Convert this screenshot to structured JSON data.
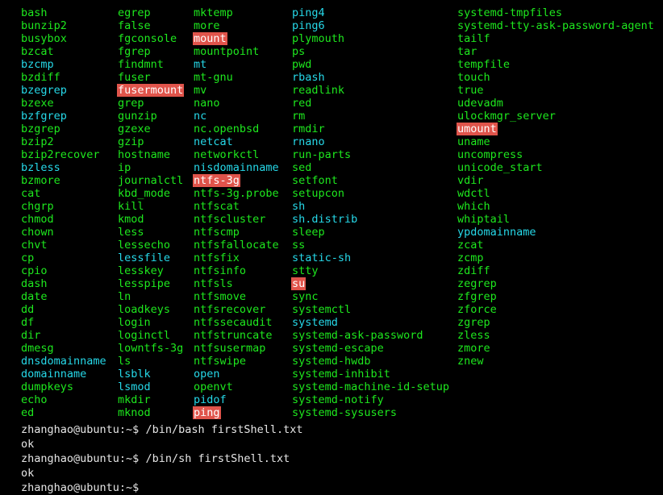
{
  "terminal": {
    "title": "bash completion listing",
    "background_color": "#000000",
    "green_color": "#1ee81e",
    "cyan_color": "#26d8e8",
    "highlight_bg_color": "#e0544b",
    "highlight_fg_color": "#ffffff",
    "prompt_color": "#e6e6e6"
  },
  "completions": {
    "columns": [
      {
        "index": 0,
        "items": [
          {
            "name": "bash",
            "style": "green"
          },
          {
            "name": "bunzip2",
            "style": "green"
          },
          {
            "name": "busybox",
            "style": "green"
          },
          {
            "name": "bzcat",
            "style": "green"
          },
          {
            "name": "bzcmp",
            "style": "cyan"
          },
          {
            "name": "bzdiff",
            "style": "green"
          },
          {
            "name": "bzegrep",
            "style": "cyan"
          },
          {
            "name": "bzexe",
            "style": "green"
          },
          {
            "name": "bzfgrep",
            "style": "cyan"
          },
          {
            "name": "bzgrep",
            "style": "green"
          },
          {
            "name": "bzip2",
            "style": "green"
          },
          {
            "name": "bzip2recover",
            "style": "green"
          },
          {
            "name": "bzless",
            "style": "cyan"
          },
          {
            "name": "bzmore",
            "style": "green"
          },
          {
            "name": "cat",
            "style": "green"
          },
          {
            "name": "chgrp",
            "style": "green"
          },
          {
            "name": "chmod",
            "style": "green"
          },
          {
            "name": "chown",
            "style": "green"
          },
          {
            "name": "chvt",
            "style": "green"
          },
          {
            "name": "cp",
            "style": "green"
          },
          {
            "name": "cpio",
            "style": "green"
          },
          {
            "name": "dash",
            "style": "green"
          },
          {
            "name": "date",
            "style": "green"
          },
          {
            "name": "dd",
            "style": "green"
          },
          {
            "name": "df",
            "style": "green"
          },
          {
            "name": "dir",
            "style": "green"
          },
          {
            "name": "dmesg",
            "style": "green"
          },
          {
            "name": "dnsdomainname",
            "style": "cyan"
          },
          {
            "name": "domainname",
            "style": "cyan"
          },
          {
            "name": "dumpkeys",
            "style": "green"
          },
          {
            "name": "echo",
            "style": "green"
          },
          {
            "name": "ed",
            "style": "green"
          }
        ]
      },
      {
        "index": 1,
        "items": [
          {
            "name": "egrep",
            "style": "green"
          },
          {
            "name": "false",
            "style": "green"
          },
          {
            "name": "fgconsole",
            "style": "green"
          },
          {
            "name": "fgrep",
            "style": "green"
          },
          {
            "name": "findmnt",
            "style": "green"
          },
          {
            "name": "fuser",
            "style": "green"
          },
          {
            "name": "fusermount",
            "style": "highlight"
          },
          {
            "name": "grep",
            "style": "green"
          },
          {
            "name": "gunzip",
            "style": "green"
          },
          {
            "name": "gzexe",
            "style": "green"
          },
          {
            "name": "gzip",
            "style": "green"
          },
          {
            "name": "hostname",
            "style": "green"
          },
          {
            "name": "ip",
            "style": "green"
          },
          {
            "name": "journalctl",
            "style": "green"
          },
          {
            "name": "kbd_mode",
            "style": "green"
          },
          {
            "name": "kill",
            "style": "green"
          },
          {
            "name": "kmod",
            "style": "green"
          },
          {
            "name": "less",
            "style": "green"
          },
          {
            "name": "lessecho",
            "style": "green"
          },
          {
            "name": "lessfile",
            "style": "cyan"
          },
          {
            "name": "lesskey",
            "style": "green"
          },
          {
            "name": "lesspipe",
            "style": "green"
          },
          {
            "name": "ln",
            "style": "green"
          },
          {
            "name": "loadkeys",
            "style": "green"
          },
          {
            "name": "login",
            "style": "green"
          },
          {
            "name": "loginctl",
            "style": "green"
          },
          {
            "name": "lowntfs-3g",
            "style": "green"
          },
          {
            "name": "ls",
            "style": "green"
          },
          {
            "name": "lsblk",
            "style": "cyan"
          },
          {
            "name": "lsmod",
            "style": "cyan"
          },
          {
            "name": "mkdir",
            "style": "green"
          },
          {
            "name": "mknod",
            "style": "green"
          }
        ]
      },
      {
        "index": 2,
        "items": [
          {
            "name": "mktemp",
            "style": "green"
          },
          {
            "name": "more",
            "style": "green"
          },
          {
            "name": "mount",
            "style": "highlight"
          },
          {
            "name": "mountpoint",
            "style": "green"
          },
          {
            "name": "mt",
            "style": "cyan"
          },
          {
            "name": "mt-gnu",
            "style": "green"
          },
          {
            "name": "mv",
            "style": "green"
          },
          {
            "name": "nano",
            "style": "green"
          },
          {
            "name": "nc",
            "style": "cyan"
          },
          {
            "name": "nc.openbsd",
            "style": "green"
          },
          {
            "name": "netcat",
            "style": "cyan"
          },
          {
            "name": "networkctl",
            "style": "green"
          },
          {
            "name": "nisdomainname",
            "style": "cyan"
          },
          {
            "name": "ntfs-3g",
            "style": "highlight"
          },
          {
            "name": "ntfs-3g.probe",
            "style": "green"
          },
          {
            "name": "ntfscat",
            "style": "green"
          },
          {
            "name": "ntfscluster",
            "style": "green"
          },
          {
            "name": "ntfscmp",
            "style": "green"
          },
          {
            "name": "ntfsfallocate",
            "style": "green"
          },
          {
            "name": "ntfsfix",
            "style": "green"
          },
          {
            "name": "ntfsinfo",
            "style": "green"
          },
          {
            "name": "ntfsls",
            "style": "green"
          },
          {
            "name": "ntfsmove",
            "style": "green"
          },
          {
            "name": "ntfsrecover",
            "style": "green"
          },
          {
            "name": "ntfssecaudit",
            "style": "green"
          },
          {
            "name": "ntfstruncate",
            "style": "green"
          },
          {
            "name": "ntfsusermap",
            "style": "green"
          },
          {
            "name": "ntfswipe",
            "style": "green"
          },
          {
            "name": "open",
            "style": "cyan"
          },
          {
            "name": "openvt",
            "style": "green"
          },
          {
            "name": "pidof",
            "style": "cyan"
          },
          {
            "name": "ping",
            "style": "highlight"
          }
        ]
      },
      {
        "index": 3,
        "items": [
          {
            "name": "ping4",
            "style": "cyan"
          },
          {
            "name": "ping6",
            "style": "cyan"
          },
          {
            "name": "plymouth",
            "style": "green"
          },
          {
            "name": "ps",
            "style": "green"
          },
          {
            "name": "pwd",
            "style": "green"
          },
          {
            "name": "rbash",
            "style": "cyan"
          },
          {
            "name": "readlink",
            "style": "green"
          },
          {
            "name": "red",
            "style": "green"
          },
          {
            "name": "rm",
            "style": "green"
          },
          {
            "name": "rmdir",
            "style": "green"
          },
          {
            "name": "rnano",
            "style": "cyan"
          },
          {
            "name": "run-parts",
            "style": "green"
          },
          {
            "name": "sed",
            "style": "green"
          },
          {
            "name": "setfont",
            "style": "green"
          },
          {
            "name": "setupcon",
            "style": "green"
          },
          {
            "name": "sh",
            "style": "cyan"
          },
          {
            "name": "sh.distrib",
            "style": "cyan"
          },
          {
            "name": "sleep",
            "style": "green"
          },
          {
            "name": "ss",
            "style": "green"
          },
          {
            "name": "static-sh",
            "style": "cyan"
          },
          {
            "name": "stty",
            "style": "green"
          },
          {
            "name": "su",
            "style": "highlight"
          },
          {
            "name": "sync",
            "style": "green"
          },
          {
            "name": "systemctl",
            "style": "green"
          },
          {
            "name": "systemd",
            "style": "cyan"
          },
          {
            "name": "systemd-ask-password",
            "style": "green"
          },
          {
            "name": "systemd-escape",
            "style": "green"
          },
          {
            "name": "systemd-hwdb",
            "style": "green"
          },
          {
            "name": "systemd-inhibit",
            "style": "green"
          },
          {
            "name": "systemd-machine-id-setup",
            "style": "green"
          },
          {
            "name": "systemd-notify",
            "style": "green"
          },
          {
            "name": "systemd-sysusers",
            "style": "green"
          }
        ]
      },
      {
        "index": 4,
        "items": [
          {
            "name": "systemd-tmpfiles",
            "style": "green"
          },
          {
            "name": "systemd-tty-ask-password-agent",
            "style": "green"
          },
          {
            "name": "tailf",
            "style": "green"
          },
          {
            "name": "tar",
            "style": "green"
          },
          {
            "name": "tempfile",
            "style": "green"
          },
          {
            "name": "touch",
            "style": "green"
          },
          {
            "name": "true",
            "style": "green"
          },
          {
            "name": "udevadm",
            "style": "green"
          },
          {
            "name": "ulockmgr_server",
            "style": "green"
          },
          {
            "name": "umount",
            "style": "highlight"
          },
          {
            "name": "uname",
            "style": "green"
          },
          {
            "name": "uncompress",
            "style": "green"
          },
          {
            "name": "unicode_start",
            "style": "green"
          },
          {
            "name": "vdir",
            "style": "green"
          },
          {
            "name": "wdctl",
            "style": "green"
          },
          {
            "name": "which",
            "style": "green"
          },
          {
            "name": "whiptail",
            "style": "green"
          },
          {
            "name": "ypdomainname",
            "style": "cyan"
          },
          {
            "name": "zcat",
            "style": "green"
          },
          {
            "name": "zcmp",
            "style": "green"
          },
          {
            "name": "zdiff",
            "style": "green"
          },
          {
            "name": "zegrep",
            "style": "green"
          },
          {
            "name": "zfgrep",
            "style": "green"
          },
          {
            "name": "zforce",
            "style": "green"
          },
          {
            "name": "zgrep",
            "style": "green"
          },
          {
            "name": "zless",
            "style": "green"
          },
          {
            "name": "zmore",
            "style": "green"
          },
          {
            "name": "znew",
            "style": "green"
          }
        ]
      }
    ]
  },
  "shell": {
    "prompt": "zhanghao@ubuntu:~$",
    "lines": [
      {
        "type": "command",
        "prompt": "zhanghao@ubuntu:~$",
        "command": " /bin/bash firstShell.txt"
      },
      {
        "type": "output",
        "text": "ok"
      },
      {
        "type": "command",
        "prompt": "zhanghao@ubuntu:~$",
        "command": " /bin/sh firstShell.txt"
      },
      {
        "type": "output",
        "text": "ok"
      },
      {
        "type": "command",
        "prompt": "zhanghao@ubuntu:~$",
        "command": ""
      }
    ]
  }
}
